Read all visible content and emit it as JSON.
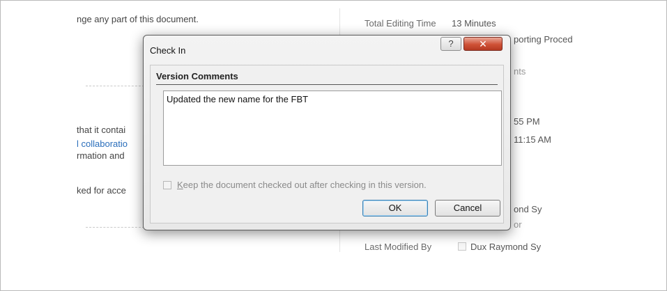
{
  "background": {
    "left_lines": [
      "nge any part of this document.",
      "that it contai",
      "l collaboratio",
      "rmation and",
      "ked for acce"
    ],
    "right": {
      "total_editing_time_label": "Total Editing Time",
      "total_editing_time_value": "13 Minutes",
      "title_fragment": "porting Proced",
      "comments_fragment": "nts",
      "created_fragment": "55 PM",
      "modified_fragment": "11:15 AM",
      "author_fragment": "ond Sy",
      "manager_fragment": "or",
      "last_modified_by_label": "Last Modified By",
      "last_modified_by_value": "Dux Raymond Sy"
    }
  },
  "dialog": {
    "title": "Check In",
    "help_glyph": "?",
    "close_glyph": "✕",
    "section_title": "Version Comments",
    "comments_value": "Updated the new name for the FBT",
    "keep_checked_out": {
      "accelerator": "K",
      "label_rest": "eep the document checked out after checking in this version.",
      "checked": false
    },
    "ok_label": "OK",
    "cancel_label": "Cancel"
  }
}
